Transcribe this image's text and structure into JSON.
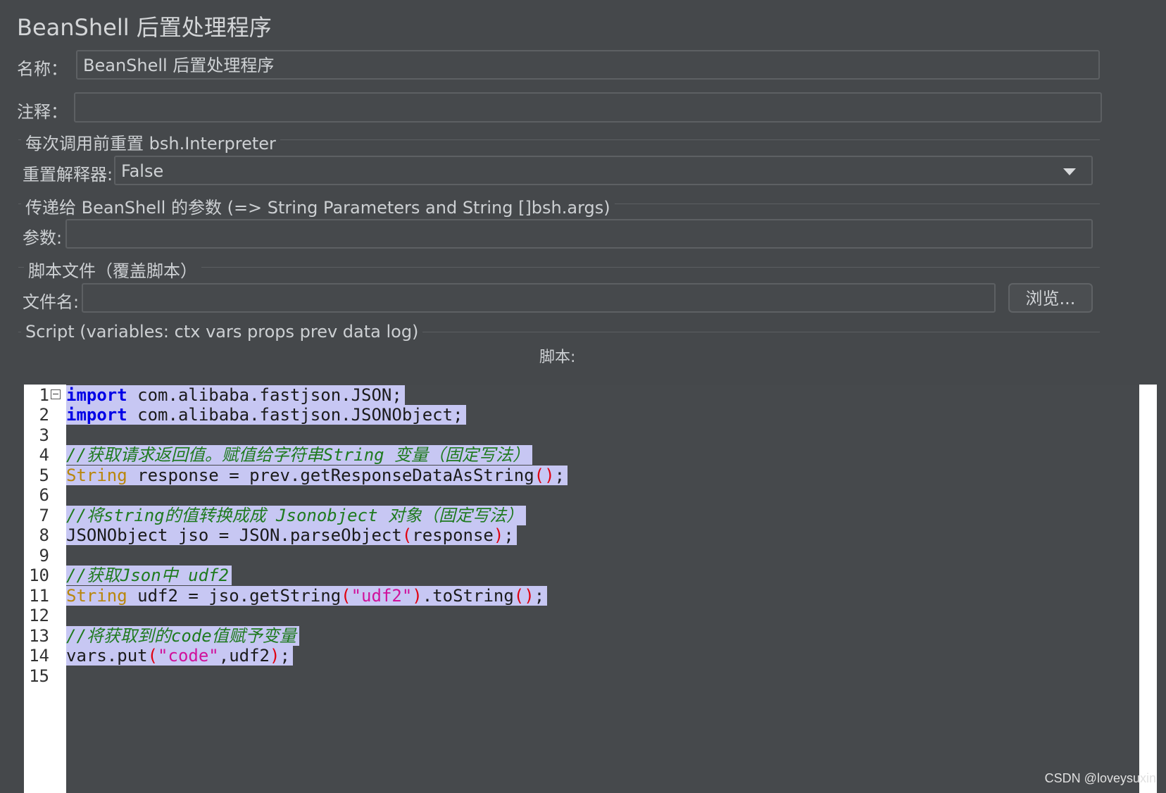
{
  "panel": {
    "title": "BeanShell 后置处理程序"
  },
  "name_field": {
    "label": "名称：",
    "value": "BeanShell 后置处理程序"
  },
  "comment_field": {
    "label": "注释：",
    "value": ""
  },
  "reset_group": {
    "title": "每次调用前重置 bsh.Interpreter",
    "label": "重置解释器:",
    "selected": "False"
  },
  "params_group": {
    "title": "传递给 BeanShell 的参数 (=> String Parameters and String []bsh.args)",
    "label": "参数:",
    "value": ""
  },
  "file_group": {
    "title": "脚本文件（覆盖脚本）",
    "label": "文件名:",
    "value": "",
    "browse_label": "浏览..."
  },
  "script_group": {
    "title": "Script (variables: ctx vars props prev data log)",
    "script_label": "脚本:"
  },
  "editor": {
    "line_numbers": [
      "1",
      "2",
      "3",
      "4",
      "5",
      "6",
      "7",
      "8",
      "9",
      "10",
      "11",
      "12",
      "13",
      "14",
      "15"
    ],
    "lines": [
      "import com.alibaba.fastjson.JSON;",
      "import com.alibaba.fastjson.JSONObject;",
      "",
      "//获取请求返回值。赋值给字符串String 变量（固定写法）",
      "String response = prev.getResponseDataAsString();",
      "",
      "//将string的值转换成成 Jsonobject 对象（固定写法）",
      "JSONObject jso = JSON.parseObject(response);",
      "",
      "//获取Json中 udf2",
      "String udf2 = jso.getString(\"udf2\").toString();",
      "",
      "//将获取到的code值赋予变量",
      "vars.put(\"code\",udf2);",
      ""
    ]
  },
  "watermark": "CSDN @loveysuxin",
  "colors": {
    "keyword": "#0000e6",
    "type": "#b8860b",
    "comment": "#1f7a1f",
    "string": "#d0119b",
    "selection": "#c7c7f3"
  }
}
